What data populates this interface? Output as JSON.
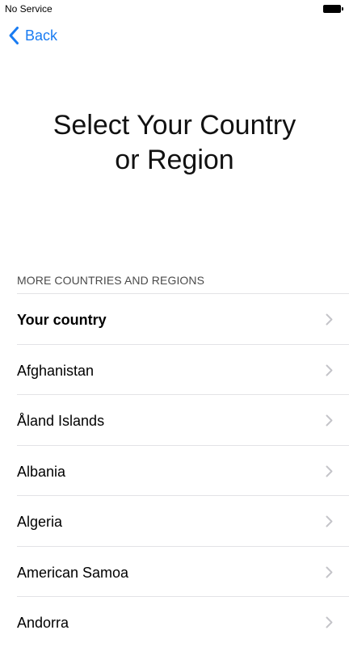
{
  "status_bar": {
    "carrier": "No Service",
    "battery_icon": "battery-full-icon"
  },
  "nav": {
    "back_label": "Back",
    "back_icon": "chevron-left-icon",
    "accent_color": "#1a7cf2"
  },
  "title": {
    "line1": "Select Your Country",
    "line2": "or Region"
  },
  "section": {
    "header": "MORE COUNTRIES AND REGIONS"
  },
  "countries": [
    {
      "label": "Your country",
      "bold": true
    },
    {
      "label": "Afghanistan",
      "bold": false
    },
    {
      "label": "Åland Islands",
      "bold": false
    },
    {
      "label": "Albania",
      "bold": false
    },
    {
      "label": "Algeria",
      "bold": false
    },
    {
      "label": "American Samoa",
      "bold": false
    },
    {
      "label": "Andorra",
      "bold": false
    }
  ]
}
